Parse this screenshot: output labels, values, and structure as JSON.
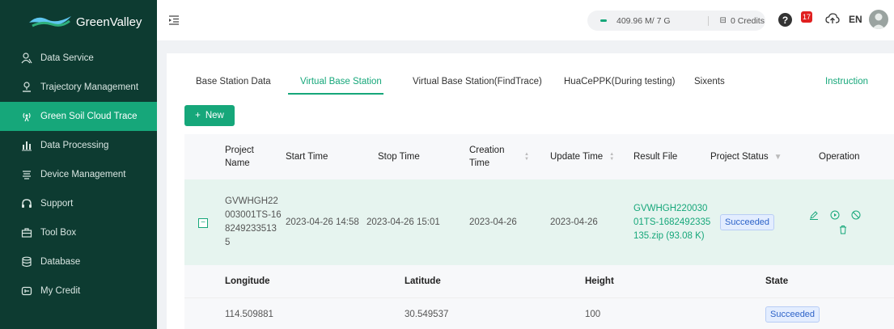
{
  "brand": {
    "name": "GreenValley"
  },
  "sidebar": {
    "items": [
      {
        "label": "Data Service",
        "icon": "users-icon"
      },
      {
        "label": "Trajectory Management",
        "icon": "person-pin-icon"
      },
      {
        "label": "Green Soil Cloud Trace",
        "icon": "signal-icon",
        "active": true
      },
      {
        "label": "Data Processing",
        "icon": "bars-icon"
      },
      {
        "label": "Device Management",
        "icon": "device-icon"
      },
      {
        "label": "Support",
        "icon": "headset-icon"
      },
      {
        "label": "Tool Box",
        "icon": "toolbox-icon"
      },
      {
        "label": "Database",
        "icon": "database-icon"
      },
      {
        "label": "My Credit",
        "icon": "credit-icon"
      }
    ]
  },
  "topbar": {
    "storage": "409.96 M/ 7 G",
    "credits": "0 Credits",
    "notifications": "17",
    "language": "EN"
  },
  "tabs": [
    {
      "label": "Base Station Data"
    },
    {
      "label": "Virtual Base Station",
      "active": true
    },
    {
      "label": "Virtual Base Station(FindTrace)"
    },
    {
      "label": "HuaCePPK(During testing)"
    },
    {
      "label": "Sixents"
    }
  ],
  "instruction": "Instruction",
  "new_button": "New",
  "table": {
    "columns": {
      "project_name": "Project Name",
      "start_time": "Start Time",
      "stop_time": "Stop Time",
      "creation_time": "Creation Time",
      "update_time": "Update Time",
      "result_file": "Result File",
      "project_status": "Project Status",
      "operation": "Operation"
    },
    "rows": [
      {
        "project_name": "GVWHGH22003001TS-1682492335135",
        "start_time": "2023-04-26 14:58",
        "stop_time": "2023-04-26 15:01",
        "creation_time": "2023-04-26",
        "update_time": "2023-04-26",
        "result_file": "GVWHGH22003001TS-1682492335135.zip (93.08 K)",
        "status": "Succeeded"
      }
    ],
    "sub_columns": {
      "longitude": "Longitude",
      "latitude": "Latitude",
      "height": "Height",
      "state": "State"
    },
    "sub_rows": [
      {
        "longitude": "114.509881",
        "latitude": "30.549537",
        "height": "100",
        "state": "Succeeded"
      }
    ]
  },
  "colors": {
    "sidebar_bg": "#0d3b31",
    "accent": "#16a77a",
    "row_highlight": "#e6f4ef"
  }
}
